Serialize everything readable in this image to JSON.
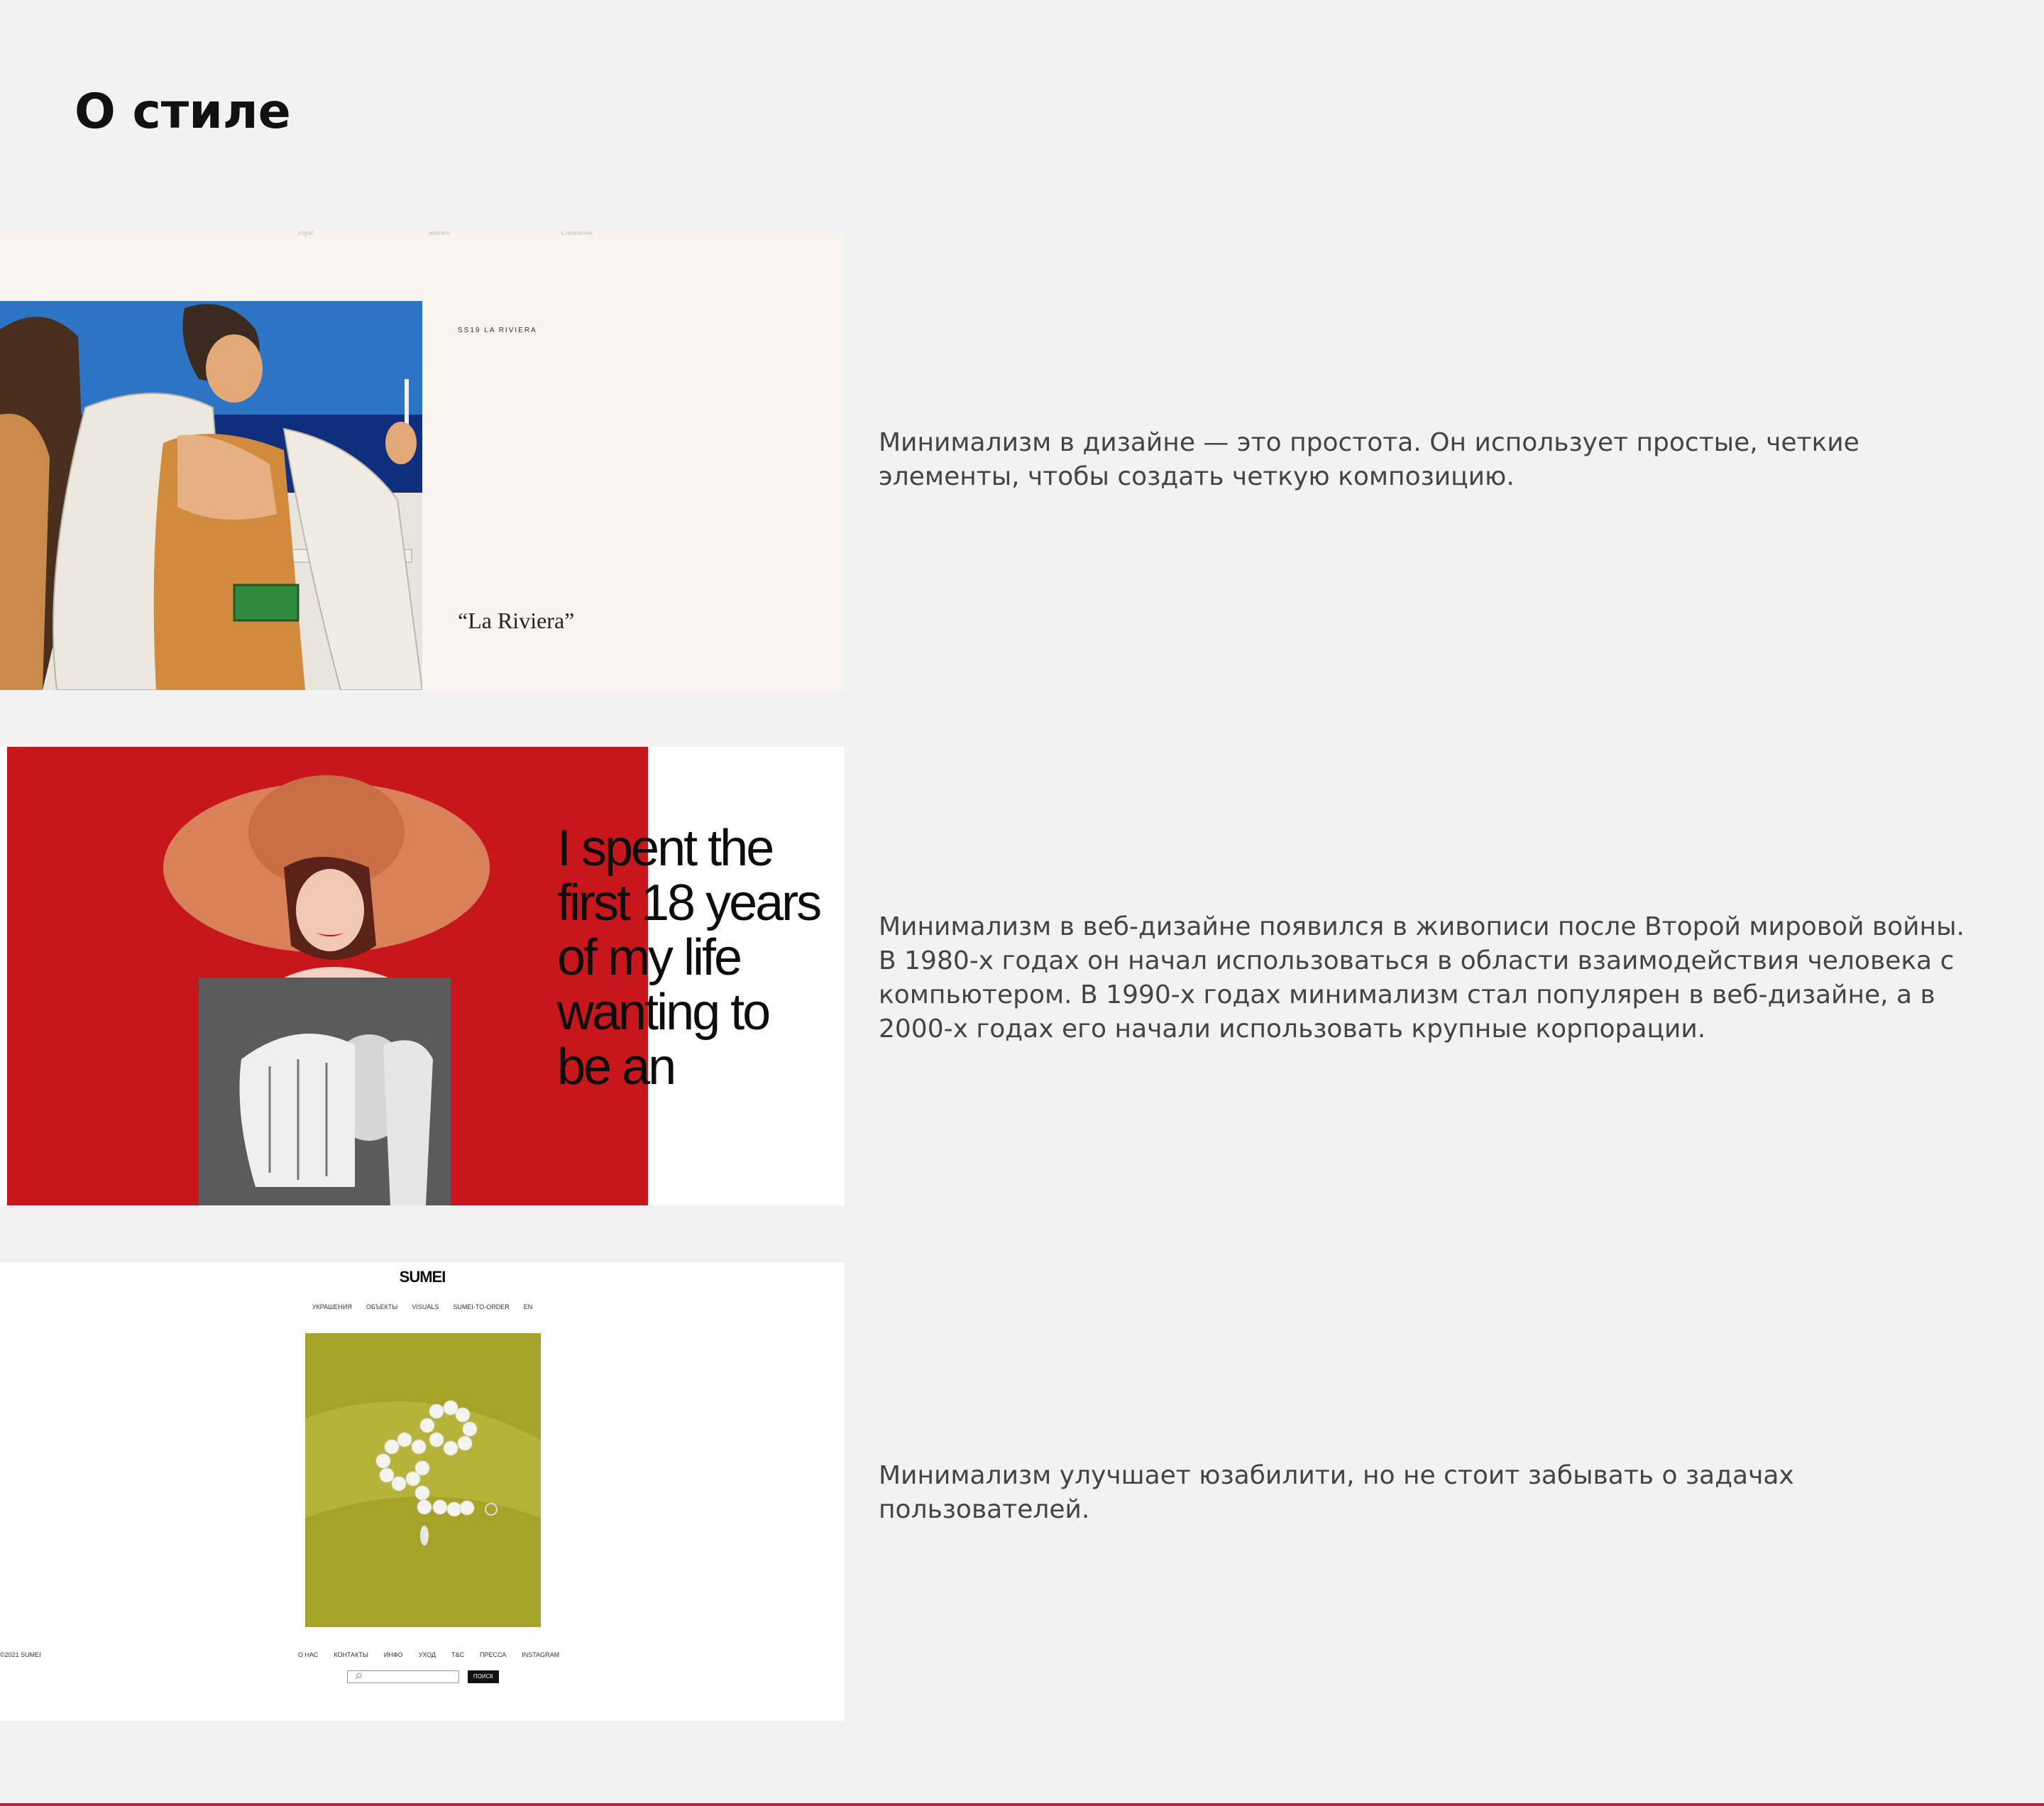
{
  "page": {
    "title": "О стиле"
  },
  "sections": [
    {
      "description": "Минимализм в дизайне — это простота. Он использует простые, четкие элементы, чтобы создать четкую композицию.",
      "shot": {
        "nav": [
          "Topic",
          "Stories",
          "Lookbook"
        ],
        "tag": "SS19 LA RIVIERA",
        "title": "“La Riviera”"
      }
    },
    {
      "description": "Минимализм в веб-дизайне появился в живописи после Второй мировой войны. В 1980-х годах он начал использоваться в области взаимодействия человека с компьютером. В 1990-х годах минимализм стал популярен в веб-дизайне, а в 2000-х годах его начали использовать крупные корпорации.",
      "shot": {
        "headline_lines": [
          "I spent the",
          "first 18 years",
          "of my life",
          "wanting to",
          "be an"
        ]
      }
    },
    {
      "description": "Минимализм улучшает юзабилити, но не стоит забывать о задачах пользователей.",
      "shot": {
        "logo": "SUMEI",
        "menu": [
          "УКРАШЕНИЯ",
          "ОБЪЕКТЫ",
          "VISUALS",
          "SUMEI-TO-ORDER",
          "EN"
        ],
        "copyright": "©2021 SUMEI",
        "footer_links": [
          "О НАС",
          "КОНТАКТЫ",
          "ИНФО",
          "УХОД",
          "T&C",
          "ПРЕССА",
          "INSTAGRAM"
        ],
        "search_button": "ПОИСК"
      }
    }
  ],
  "colors": {
    "background": "#f2f2f2",
    "accent_red": "#c8161d",
    "bottom_line": "#b3283f"
  }
}
